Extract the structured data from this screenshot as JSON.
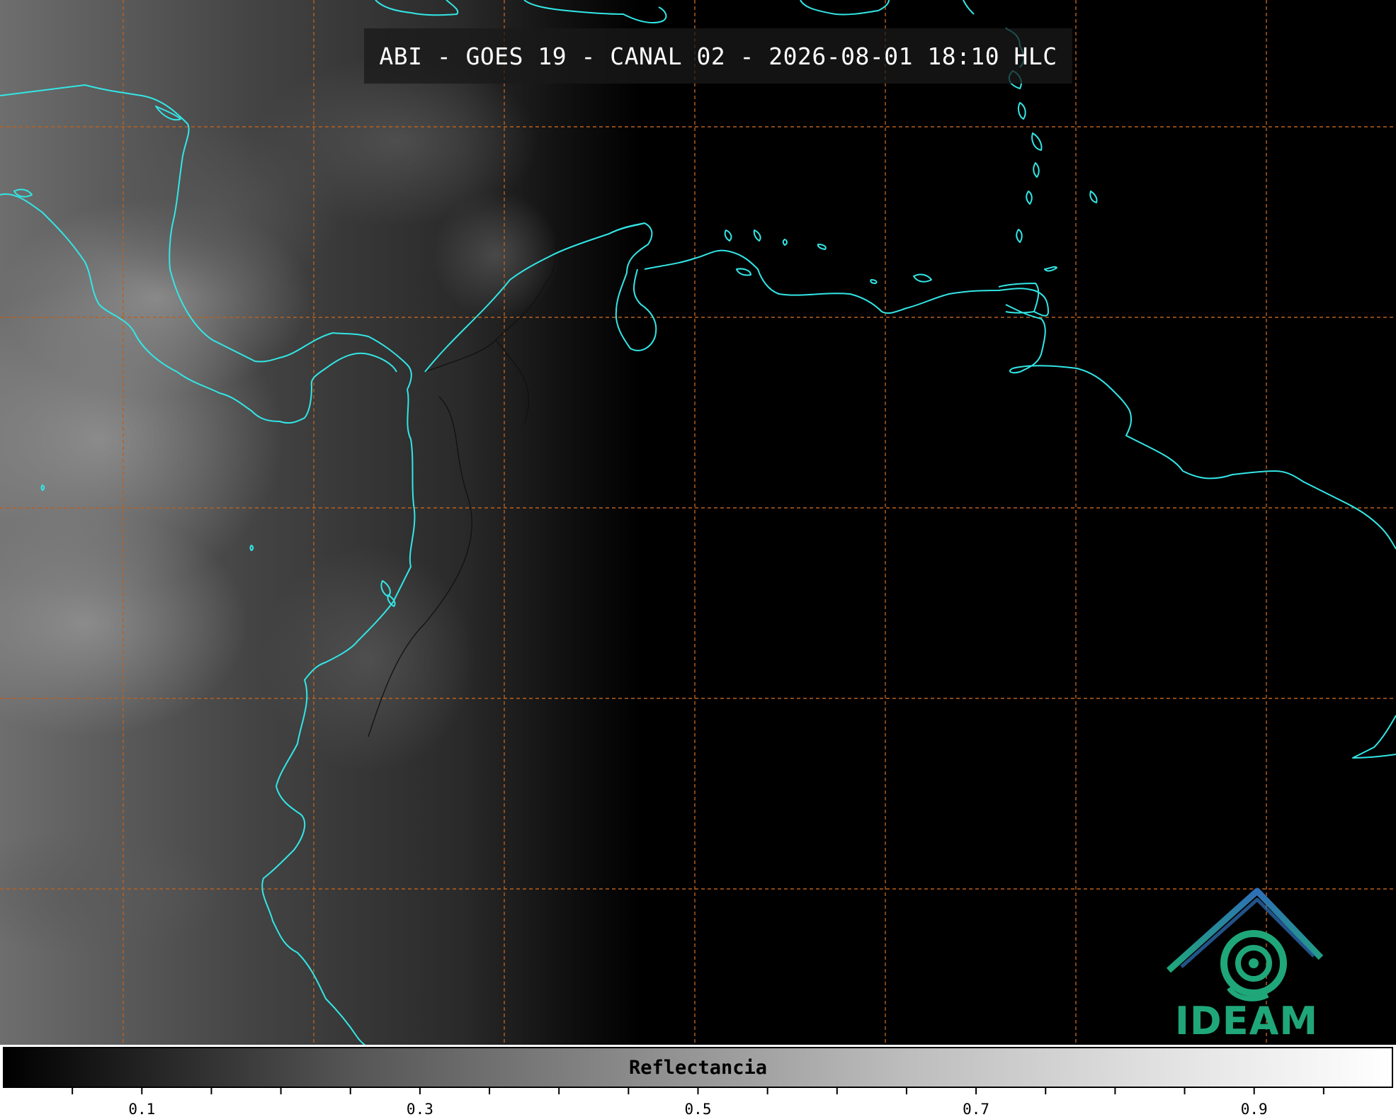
{
  "title": "ABI - GOES 19 - CANAL 02 - 2026-08-01 18:10 HLC",
  "logo_text": "IDEAM",
  "colors": {
    "coastline": "#33e6e6",
    "grid": "#b8611f",
    "logo_green": "#1fa77a",
    "logo_blue": "#2e6fb5",
    "background": "#000000"
  },
  "colorbar": {
    "label": "Reflectancia",
    "range": [
      0.0,
      1.0
    ],
    "colormap": "grayscale",
    "tick_labels": [
      "0.1",
      "0.3",
      "0.5",
      "0.7",
      "0.9"
    ],
    "tick_values": [
      0.1,
      0.3,
      0.5,
      0.7,
      0.9
    ]
  }
}
